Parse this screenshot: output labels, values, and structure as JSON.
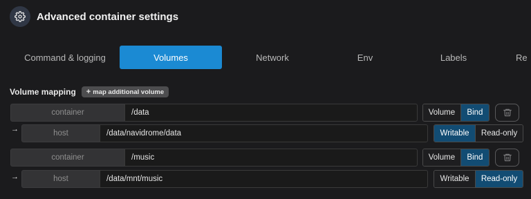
{
  "header": {
    "title": "Advanced container settings",
    "icon": "gear-icon"
  },
  "tabs": [
    {
      "label": "Command & logging",
      "active": false
    },
    {
      "label": "Volumes",
      "active": true
    },
    {
      "label": "Network",
      "active": false
    },
    {
      "label": "Env",
      "active": false
    },
    {
      "label": "Labels",
      "active": false
    },
    {
      "label": "Re",
      "active": false
    }
  ],
  "volumes": {
    "label": "Volume mapping",
    "add_button": "map additional volume",
    "mappings": [
      {
        "container_label": "container",
        "container_path": "/data",
        "type_options": [
          "Volume",
          "Bind"
        ],
        "type_selected": "Bind",
        "host_label": "host",
        "host_path": "/data/navidrome/data",
        "mode_options": [
          "Writable",
          "Read-only"
        ],
        "mode_selected": "Writable"
      },
      {
        "container_label": "container",
        "container_path": "/music",
        "type_options": [
          "Volume",
          "Bind"
        ],
        "type_selected": "Bind",
        "host_label": "host",
        "host_path": "/data/mnt/music",
        "mode_options": [
          "Writable",
          "Read-only"
        ],
        "mode_selected": "Read-only"
      }
    ]
  },
  "colors": {
    "accent": "#1b8ad3",
    "selected": "#124c73",
    "background": "#1b1b1d"
  }
}
